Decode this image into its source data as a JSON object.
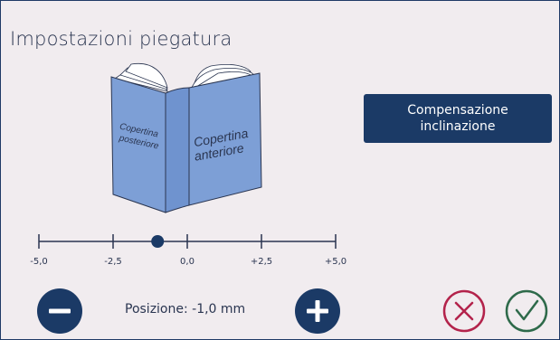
{
  "page": {
    "title": "Impostazioni piegatura"
  },
  "book": {
    "back_cover_label_line1": "Copertina",
    "back_cover_label_line2": "posteriore",
    "front_cover_label_line1": "Copertina",
    "front_cover_label_line2": "anteriore"
  },
  "compensation_button": {
    "line1": "Compensazione",
    "line2": "inclinazione"
  },
  "slider": {
    "min": -5.0,
    "max": 5.0,
    "value": -1.0,
    "ticks": [
      "-5,0",
      "-2,5",
      "0,0",
      "+2,5",
      "+5,0"
    ]
  },
  "position": {
    "label": "Posizione: -1,0 mm"
  },
  "icons": {
    "decrease": "minus-icon",
    "increase": "plus-icon",
    "cancel": "close-icon",
    "confirm": "check-icon"
  },
  "colors": {
    "background": "#f1ecef",
    "primary": "#1b3a66",
    "book_blue": "#7d9fd6",
    "cancel": "#b3234b",
    "confirm": "#2e6a4a"
  }
}
